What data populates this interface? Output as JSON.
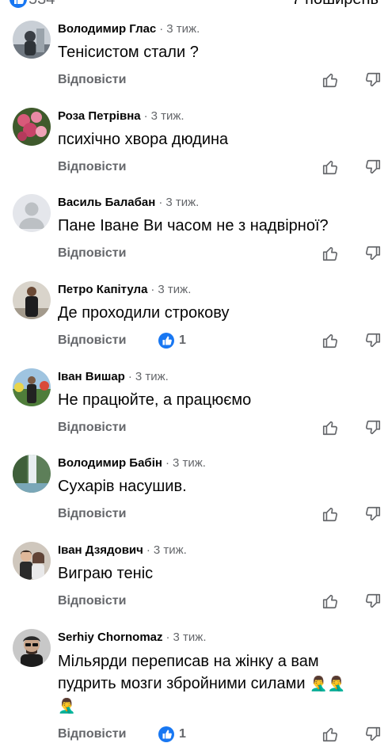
{
  "header": {
    "reaction_count": "534",
    "shares": "7 поширень"
  },
  "actions": {
    "reply_label": "Відповісти"
  },
  "colors": {
    "like_blue": "#1877f2",
    "meta_gray": "#65676b"
  },
  "comments": [
    {
      "name": "Володимир Глас",
      "time": "3 тиж.",
      "text": "Тенісистом стали ?"
    },
    {
      "name": "Роза Петрівна",
      "time": "3 тиж.",
      "text": "психічно хвора дюдина"
    },
    {
      "name": "Василь Балабан",
      "time": "3 тиж.",
      "text": "Пане Іване Ви часом не з надвірної?"
    },
    {
      "name": "Петро Капітула",
      "time": "3 тиж.",
      "text": "Де проходили строкову",
      "likes": "1"
    },
    {
      "name": "Іван Вишар",
      "time": "3 тиж.",
      "text": "Не працюйте, а працюємо"
    },
    {
      "name": "Володимир Бабін",
      "time": "3 тиж.",
      "text": "Сухарів насушив."
    },
    {
      "name": "Іван Дзядович",
      "time": "3 тиж.",
      "text": "Виграю теніс"
    },
    {
      "name": "Serhiy Chornomaz",
      "time": "3 тиж.",
      "text_line1": "Мільярди переписав на жінку а вам",
      "text_line2": "пудрить мозги збройними силами",
      "emoji": "🤦‍♂️",
      "likes": "1"
    }
  ]
}
